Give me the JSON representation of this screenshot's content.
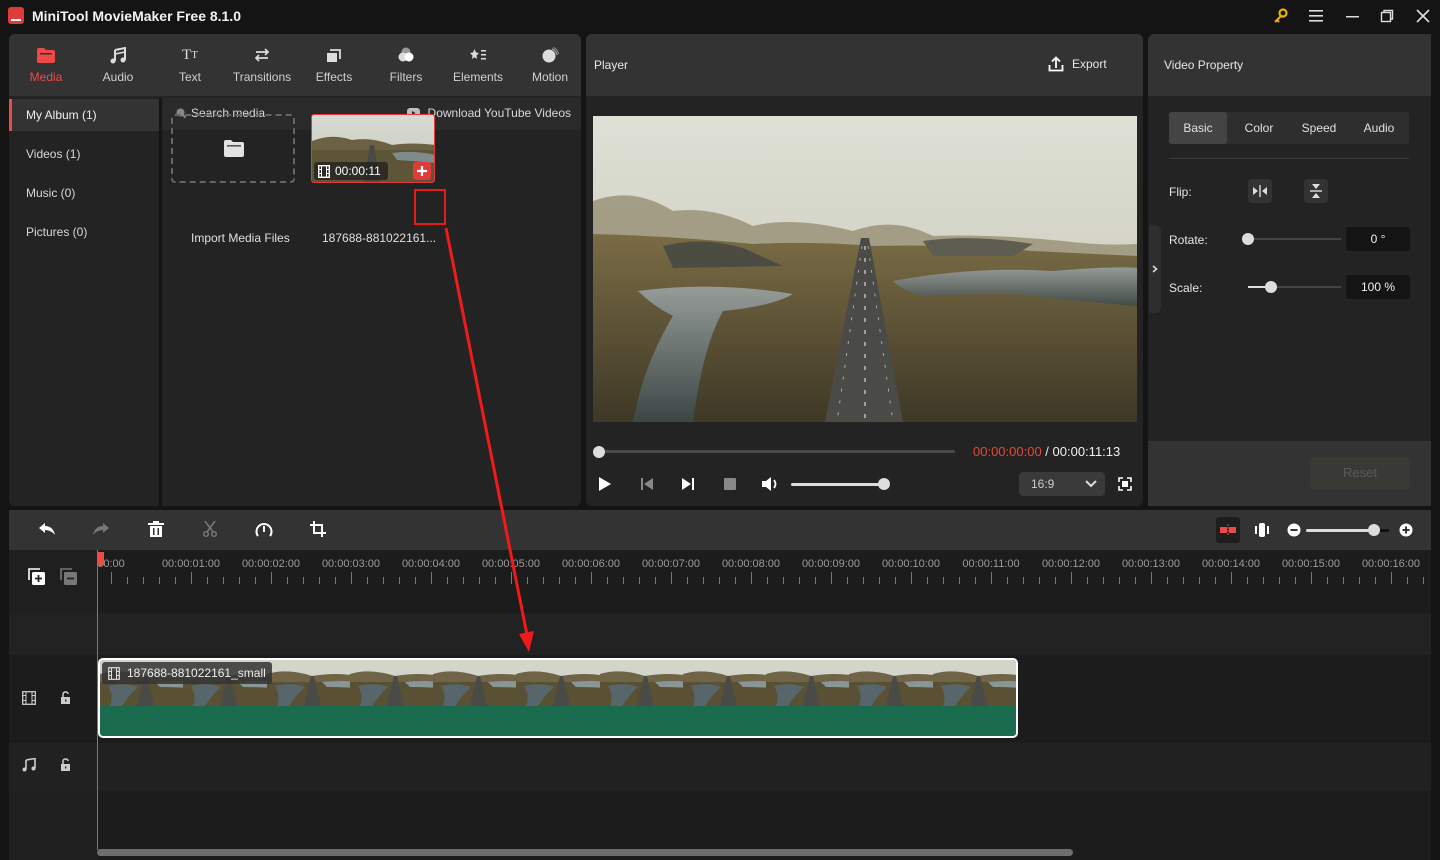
{
  "app": {
    "title": "MiniTool MovieMaker Free 8.1.0"
  },
  "window_controls": [
    "key-icon",
    "menu-icon",
    "minimize-icon",
    "restore-icon",
    "close-icon"
  ],
  "media_tabs": [
    {
      "label": "Media",
      "icon": "folder-icon",
      "active": true
    },
    {
      "label": "Audio",
      "icon": "music-note-icon"
    },
    {
      "label": "Text",
      "icon": "text-icon"
    },
    {
      "label": "Transitions",
      "icon": "transitions-icon"
    },
    {
      "label": "Effects",
      "icon": "effects-icon"
    },
    {
      "label": "Filters",
      "icon": "filters-icon"
    },
    {
      "label": "Elements",
      "icon": "elements-icon"
    },
    {
      "label": "Motion",
      "icon": "motion-icon"
    }
  ],
  "album_nav": [
    {
      "label": "My Album (1)",
      "active": true
    },
    {
      "label": "Videos (1)"
    },
    {
      "label": "Music (0)"
    },
    {
      "label": "Pictures (0)"
    }
  ],
  "media_toolbar": {
    "search_placeholder": "Search media",
    "download_label": "Download YouTube Videos"
  },
  "media_items": {
    "import_label": "Import Media Files",
    "clip": {
      "name": "187688-881022161...",
      "duration": "00:00:11"
    }
  },
  "player": {
    "title": "Player",
    "export_label": "Export",
    "current_time": "00:00:00:00",
    "separator": " / ",
    "total_time": "00:00:11:13",
    "progress": 0,
    "volume": 1.0,
    "aspect_ratio": "16:9"
  },
  "property": {
    "title": "Video Property",
    "tabs": [
      "Basic",
      "Color",
      "Speed",
      "Audio"
    ],
    "active_tab": "Basic",
    "flip_label": "Flip:",
    "rotate_label": "Rotate:",
    "rotate_value": "0 °",
    "rotate_fraction": 0,
    "scale_label": "Scale:",
    "scale_value": "100 %",
    "scale_fraction": 0.25,
    "reset_label": "Reset"
  },
  "timeline_toolbar": {
    "tools": [
      "undo-icon",
      "redo-icon",
      "delete-icon",
      "split-icon",
      "speed-icon",
      "crop-icon"
    ],
    "zoom_fraction": 0.82
  },
  "timeline": {
    "ruler_labels": [
      "00:00",
      "00:00:01:00",
      "00:00:02:00",
      "00:00:03:00",
      "00:00:04:00",
      "00:00:05:00",
      "00:00:06:00",
      "00:00:07:00",
      "00:00:08:00",
      "00:00:09:00",
      "00:00:10:00",
      "00:00:11:00",
      "00:00:12:00",
      "00:00:13:00",
      "00:00:14:00",
      "00:00:15:00",
      "00:00:16:00"
    ],
    "clip_name": "187688-881022161_small",
    "clip_color": "#1b6b4e",
    "accent": "#ef4a4a"
  }
}
